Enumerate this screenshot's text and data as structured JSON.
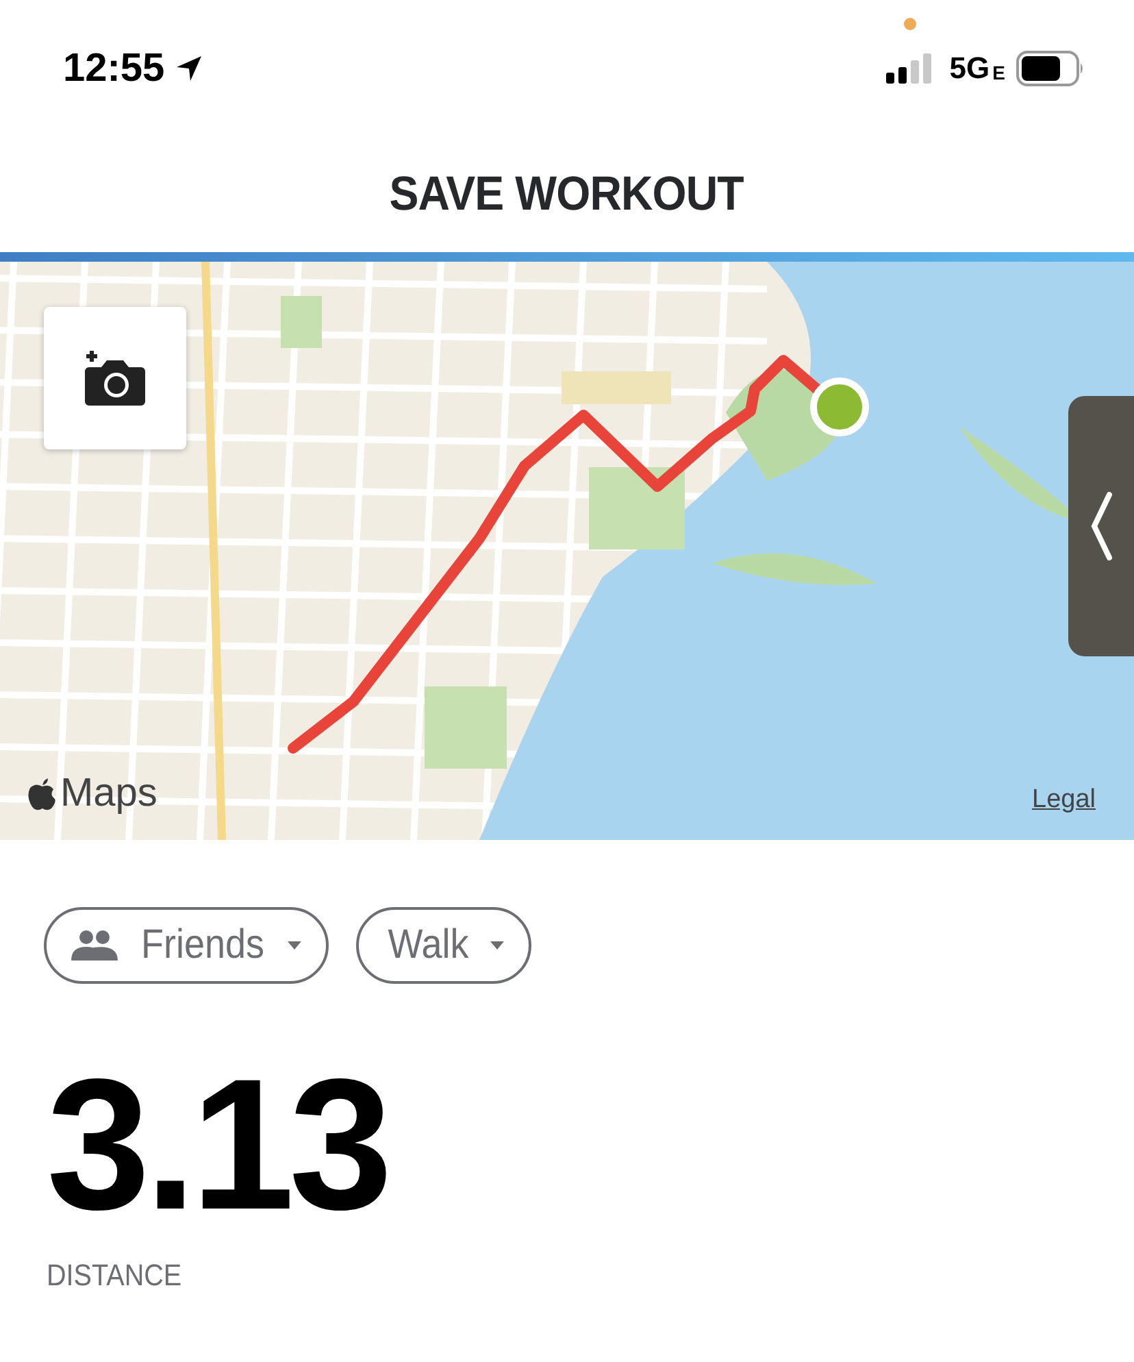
{
  "status_bar": {
    "time": "12:55",
    "network": "5G",
    "network_suffix": "E"
  },
  "header": {
    "title": "SAVE WORKOUT"
  },
  "map": {
    "logo_text": "Maps",
    "legal": "Legal"
  },
  "filters": [
    {
      "kind": "audience",
      "label": "Friends"
    },
    {
      "kind": "activity",
      "label": "Walk"
    }
  ],
  "stat": {
    "value": "3.13",
    "label": "DISTANCE"
  }
}
